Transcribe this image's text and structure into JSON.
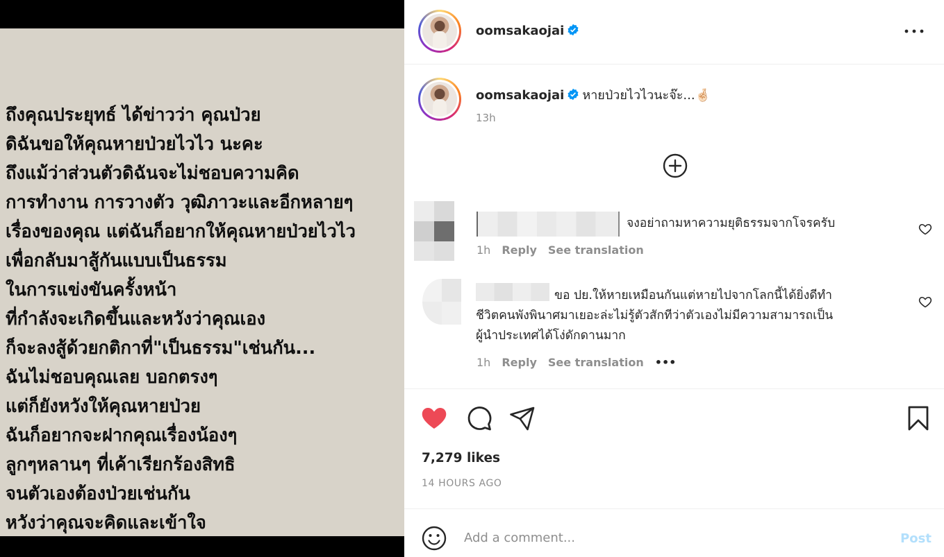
{
  "media": {
    "lines": [
      "ถึงคุณประยุทธ์ ได้ข่าวว่า คุณป่วย",
      "ดิฉันขอให้คุณหายป่วยไวไว นะคะ",
      "ถึงแม้ว่าส่วนตัวดิฉันจะไม่ชอบความคิด",
      "การทำงาน การวางตัว วุฒิภาวะและอีกหลายๆ",
      "เรื่องของคุณ แต่ฉันก็อยากให้คุณหายป่วยไวไว",
      "เพื่อกลับมาสู้กันแบบเป็นธรรม",
      "ในการแข่งขันครั้งหน้า",
      "ที่กำลังจะเกิดขึ้นและหวังว่าคุณเอง",
      "ก็จะลงสู้ด้วยกติกาที่\"เป็นธรรม\"เช่นกัน...",
      "ฉันไม่ชอบคุณเลย บอกตรงๆ",
      "แต่ก็ยังหวังให้คุณหายป่วย",
      "ฉันก็อยากจะฝากคุณเรื่องน้องๆ",
      "ลูกๆหลานๆ ที่เค้าเรียกร้องสิทธิ",
      "จนตัวเองต้องป่วยเช่นกัน",
      "หวังว่าคุณจะคิดและเข้าใจ"
    ]
  },
  "header": {
    "username": "oomsakaojai",
    "more_icon": "more-horizontal-icon"
  },
  "caption": {
    "username": "oomsakaojai",
    "text": "หายป่วยไวไวนะจ๊ะ...🤞🏻",
    "time": "13h"
  },
  "load_more_icon": "plus-circle-icon",
  "comments": [
    {
      "text": "จงอย่าถามหาความยุติธรรมจากโจรครับ",
      "time": "1h",
      "reply": "Reply",
      "translate": "See translation"
    },
    {
      "text": "ขอ ปย.ให้หายเหมือนกันแต่หายไปจากโลกนี้ได้ยิ่งดีทำชีวิตคนพังพินาศมาเยอะล่ะไม่รู้ตัวสักทีว่าตัวเองไม่มีความสามารถเป็นผู้นำประเทศได้โง่ดักดานมาก",
      "line1": "ขอ ปย.ให้หายเหมือนกันแต่หายไปจากโลกนี้ได้ยิ่งดีทำ",
      "line2": "ชีวิตคนพังพินาศมาเยอะล่ะไม่รู้ตัวสักทีว่าตัวเองไม่มีความสามารถเป็น",
      "line3": "ผู้นำประเทศได้โง่ดักดานมาก",
      "time": "1h",
      "reply": "Reply",
      "translate": "See translation",
      "more": "•••"
    }
  ],
  "stats": {
    "likes": "7,279 likes",
    "ago": "14 HOURS AGO"
  },
  "add_comment": {
    "placeholder": "Add a comment...",
    "post": "Post"
  },
  "colors": {
    "like": "#ed4956",
    "verified": "#0095f6",
    "post_disabled": "#b2dffc",
    "muted": "#8e8e8e"
  }
}
